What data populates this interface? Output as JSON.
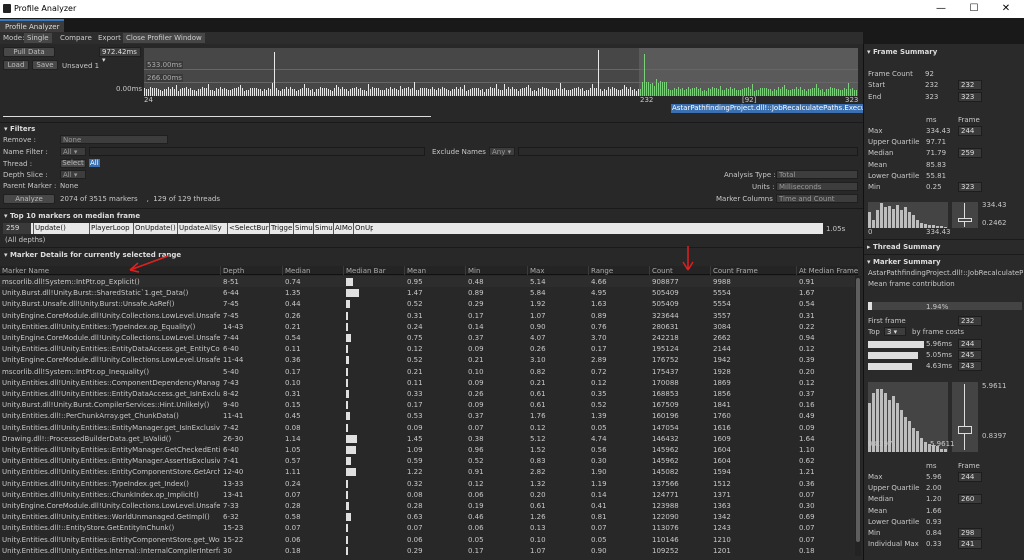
{
  "window": {
    "title": "Profile Analyzer",
    "minimize": "—",
    "maximize": "☐",
    "close": "✕"
  },
  "tab": {
    "label": "Profile Analyzer"
  },
  "mode": {
    "label": "Mode:",
    "single": "Single",
    "compare": "Compare",
    "export": "Export",
    "close_profiler": "Close Profiler Window"
  },
  "toolbar": {
    "pull_data": "Pull Data",
    "load": "Load",
    "save": "Save",
    "status": "Unsaved 1",
    "time_dropdown": "972.42ms ▾"
  },
  "graph": {
    "label_533": "533.00ms",
    "label_266": "266.00ms",
    "label_0": "0.00ms",
    "x_start": "24",
    "x_sel_start": "232",
    "x_mid": "[92]",
    "x_end": "323",
    "tooltip": "AstarPathfindingProject.dll!::JobRecalculatePaths.Execute()"
  },
  "filters": {
    "title": "Filters",
    "remove_label": "Remove :",
    "remove_value": "None",
    "name_filter_label": "Name Filter :",
    "name_filter_value": "All",
    "exclude_label": "Exclude Names :",
    "exclude_value": "Any",
    "thread_label": "Thread :",
    "thread_select": "Select",
    "thread_value": "All",
    "depth_label": "Depth Slice :",
    "depth_value": "All",
    "parent_label": "Parent Marker :",
    "parent_value": "None",
    "analysis_type_label": "Analysis Type :",
    "analysis_type_value": "Total",
    "units_label": "Units :",
    "units_value": "Milliseconds",
    "marker_columns_label": "Marker Columns :",
    "marker_columns_value": "Time and Count",
    "analyze": "Analyze",
    "summary": "2074 of 3515 markers    ,  129 of 129 threads"
  },
  "top10": {
    "title": "Top 10 markers on median frame",
    "frame": "259",
    "markers": [
      "Update()",
      "PlayerLoop",
      "OnUpdate()",
      "UpdateAllSy",
      "<SelectBur",
      "Trigge",
      "Simula",
      "Simula",
      "AIMo",
      "OnUp"
    ],
    "time": "1.05s",
    "depths": "(All depths)"
  },
  "details": {
    "title": "Marker Details for currently selected range"
  },
  "columns": [
    "Marker Name",
    "Depth",
    "Median",
    "Median Bar",
    "Mean",
    "Min",
    "Max",
    "Range",
    "Count",
    "Count Frame",
    "At Median Frame"
  ],
  "rows": [
    [
      "mscorlib.dll!System::IntPtr.op_Explicit()",
      "8-51",
      "0.74",
      "0.95",
      "0.48",
      "5.14",
      "4.66",
      "908877",
      "9988",
      "0.91"
    ],
    [
      "Unity.Burst.dll!Unity.Burst::SharedStatic`1.get_Data()",
      "6-44",
      "1.35",
      "1.47",
      "0.89",
      "5.84",
      "4.95",
      "505409",
      "5554",
      "1.67"
    ],
    [
      "Unity.Burst.Unsafe.dll!Unity.Burst::Unsafe.AsRef()",
      "7-45",
      "0.44",
      "0.52",
      "0.29",
      "1.92",
      "1.63",
      "505409",
      "5554",
      "0.54"
    ],
    [
      "UnityEngine.CoreModule.dll!Unity.Collections.LowLevel.Unsafe::Unsaf",
      "7-45",
      "0.26",
      "0.31",
      "0.17",
      "1.07",
      "0.89",
      "323644",
      "3557",
      "0.31"
    ],
    [
      "Unity.Entities.dll!Unity.Entities::TypeIndex.op_Equality()",
      "14-43",
      "0.21",
      "0.24",
      "0.14",
      "0.90",
      "0.76",
      "280631",
      "3084",
      "0.22"
    ],
    [
      "UnityEngine.CoreModule.dll!Unity.Collections.LowLevel.Unsafe::Atomi",
      "7-44",
      "0.54",
      "0.75",
      "0.37",
      "4.07",
      "3.70",
      "242218",
      "2662",
      "0.94"
    ],
    [
      "Unity.Entities.dll!Unity.Entities::EntityDataAccess.get_EntityComponen",
      "6-40",
      "0.11",
      "0.12",
      "0.09",
      "0.26",
      "0.17",
      "195124",
      "2144",
      "0.12"
    ],
    [
      "UnityEngine.CoreModule.dll!Unity.Collections.LowLevel.Unsafe::Atomi",
      "11-44",
      "0.36",
      "0.52",
      "0.21",
      "3.10",
      "2.89",
      "176752",
      "1942",
      "0.39"
    ],
    [
      "mscorlib.dll!System::IntPtr.op_Inequality()",
      "5-40",
      "0.17",
      "0.21",
      "0.10",
      "0.82",
      "0.72",
      "175437",
      "1928",
      "0.20"
    ],
    [
      "Unity.Entities.dll!Unity.Entities::ComponentDependencyManager.get_I",
      "7-43",
      "0.10",
      "0.11",
      "0.09",
      "0.21",
      "0.12",
      "170088",
      "1869",
      "0.12"
    ],
    [
      "Unity.Entities.dll!Unity.Entities::EntityDataAccess.get_IsInExclusiveTra",
      "8-42",
      "0.31",
      "0.33",
      "0.26",
      "0.61",
      "0.35",
      "168853",
      "1856",
      "0.37"
    ],
    [
      "Unity.Burst.dll!Unity.Burst.CompilerServices::Hint.Unlikely()",
      "9-40",
      "0.15",
      "0.17",
      "0.09",
      "0.61",
      "0.52",
      "167509",
      "1841",
      "0.16"
    ],
    [
      "Unity.Entities.dll!::PerChunkArray.get_ChunkData()",
      "11-41",
      "0.45",
      "0.53",
      "0.37",
      "1.76",
      "1.39",
      "160196",
      "1760",
      "0.49"
    ],
    [
      "Unity.Entities.dll!Unity.Entities::EntityManager.get_IsInExclusiveTransa",
      "7-42",
      "0.08",
      "0.09",
      "0.07",
      "0.12",
      "0.05",
      "147054",
      "1616",
      "0.09"
    ],
    [
      "Drawing.dll!::ProcessedBuilderData.get_IsValid()",
      "26-30",
      "1.14",
      "1.45",
      "0.38",
      "5.12",
      "4.74",
      "146432",
      "1609",
      "1.64"
    ],
    [
      "Unity.Entities.dll!Unity.Entities::EntityManager.GetCheckedEntityDataAcc",
      "6-40",
      "1.05",
      "1.09",
      "0.96",
      "1.52",
      "0.56",
      "145962",
      "1604",
      "1.10"
    ],
    [
      "Unity.Entities.dll!Unity.Entities::EntityManager.AssertIsExclusiveTransa",
      "7-41",
      "0.57",
      "0.59",
      "0.52",
      "0.83",
      "0.30",
      "145962",
      "1604",
      "0.62"
    ],
    [
      "Unity.Entities.dll!Unity.Entities::EntityComponentStore.GetArchetype()",
      "12-40",
      "1.11",
      "1.22",
      "0.91",
      "2.82",
      "1.90",
      "145082",
      "1594",
      "1.21"
    ],
    [
      "Unity.Entities.dll!Unity.Entities::TypeIndex.get_Index()",
      "13-33",
      "0.24",
      "0.32",
      "0.12",
      "1.32",
      "1.19",
      "137566",
      "1512",
      "0.36"
    ],
    [
      "Unity.Entities.dll!Unity.Entities::ChunkIndex.op_Implicit()",
      "13-41",
      "0.07",
      "0.08",
      "0.06",
      "0.20",
      "0.14",
      "124771",
      "1371",
      "0.07"
    ],
    [
      "UnityEngine.CoreModule.dll!Unity.Collections.LowLevel.Unsafe::Atomi",
      "7-33",
      "0.28",
      "0.28",
      "0.19",
      "0.61",
      "0.41",
      "123988",
      "1363",
      "0.30"
    ],
    [
      "Unity.Entities.dll!Unity.Entities::WorldUnmanaged.GetImpl()",
      "6-32",
      "0.58",
      "0.63",
      "0.46",
      "1.26",
      "0.81",
      "122090",
      "1342",
      "0.69"
    ],
    [
      "Unity.Entities.dll!::EntityStore.GetEntityInChunk()",
      "15-23",
      "0.07",
      "0.07",
      "0.06",
      "0.13",
      "0.07",
      "113076",
      "1243",
      "0.07"
    ],
    [
      "Unity.Entities.dll!Unity.Entities::EntityComponentStore.get_WorldSequ",
      "15-22",
      "0.06",
      "0.06",
      "0.05",
      "0.10",
      "0.05",
      "110146",
      "1210",
      "0.07"
    ],
    [
      "Unity.Entities.dll!Unity.Entities.Internal::InternalCompilerInterface.Unsa",
      "30",
      "0.18",
      "0.29",
      "0.17",
      "1.07",
      "0.90",
      "109252",
      "1201",
      "0.18"
    ]
  ],
  "median_bar_fraction": [
    0.12,
    0.22,
    0.07,
    0.04,
    0.03,
    0.09,
    0.02,
    0.06,
    0.03,
    0.02,
    0.05,
    0.02,
    0.07,
    0.01,
    0.19,
    0.17,
    0.09,
    0.18,
    0.04,
    0.01,
    0.05,
    0.09,
    0.01,
    0.01,
    0.03
  ],
  "right": {
    "frame_summary": "Frame Summary",
    "frame_count_label": "Frame Count",
    "frame_count": "92",
    "start_label": "Start",
    "start_val": "232",
    "start_box": "232",
    "end_label": "End",
    "end_val": "323",
    "end_box": "323",
    "ms": "ms",
    "frame": "Frame",
    "max_label": "Max",
    "max_val": "334.43",
    "max_frame": "244",
    "uq_label": "Upper Quartile",
    "uq_val": "97.71",
    "median_label": "Median",
    "median_val": "71.79",
    "median_frame": "259",
    "mean_label": "Mean",
    "mean_val": "85.83",
    "lq_label": "Lower Quartile",
    "lq_val": "55.81",
    "min_label": "Min",
    "min_val": "0.25",
    "min_frame": "323",
    "hist1_max": "334.43",
    "hist1_min": "0",
    "hist1_right": "334.43",
    "hist1_box": "0.2462",
    "thread_summary": "Thread Summary",
    "marker_summary": "Marker Summary",
    "marker_name": "AstarPathfindingProject.dll!::JobRecalculatePa",
    "mean_frame_contribution": "Mean frame contribution",
    "contribution": "1.94%",
    "first_frame_label": "First frame",
    "first_frame": "232",
    "top_label": "Top",
    "top_n": "3 ▾",
    "by_frame_costs": "by frame costs",
    "top_costs": [
      {
        "ms": "5.96ms",
        "frame": "244"
      },
      {
        "ms": "5.05ms",
        "frame": "245"
      },
      {
        "ms": "4.63ms",
        "frame": "243"
      }
    ],
    "hist2_left": "0.8397",
    "hist2_right": "5.9611",
    "hist2_top": "5.9611",
    "hist2_bottom": "0.8397",
    "max2_val": "5.96",
    "max2_frame": "244",
    "uq2_val": "2.00",
    "median2_val": "1.20",
    "median2_frame": "260",
    "mean2_val": "1.66",
    "lq2_val": "0.93",
    "min2_val": "0.84",
    "min2_frame": "298",
    "indiv_label": "Individual Max",
    "indiv_val": "0.33",
    "indiv_frame": "241"
  },
  "colors": {
    "accent": "#3a79bb",
    "tooltip_bg": "#3a6fb0",
    "graph_bg": "#474747",
    "annotation": "#e02020"
  }
}
